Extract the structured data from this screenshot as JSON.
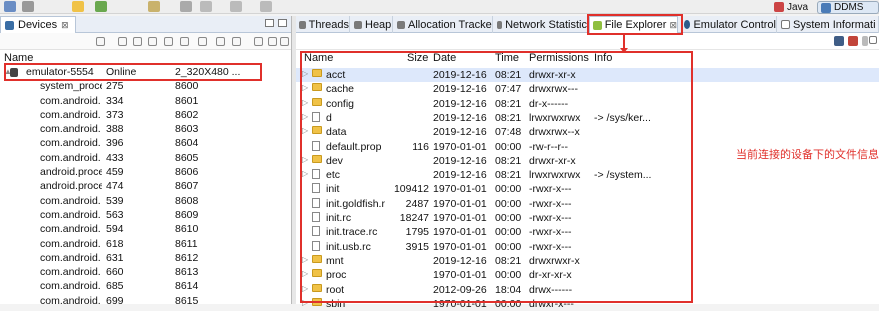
{
  "perspectives": {
    "java": "Java",
    "ddms": "DDMS"
  },
  "devices_panel": {
    "tab_label": "Devices",
    "close_glyph": "⊠",
    "column_name": "Name",
    "emulator": {
      "name": "emulator-5554",
      "status": "Online",
      "avd": "2_320X480 ..."
    },
    "processes": [
      {
        "name": "system_proce",
        "pid": "275",
        "port": "8600"
      },
      {
        "name": "com.android.",
        "pid": "334",
        "port": "8601"
      },
      {
        "name": "com.android.",
        "pid": "373",
        "port": "8602"
      },
      {
        "name": "com.android.",
        "pid": "388",
        "port": "8603"
      },
      {
        "name": "com.android.",
        "pid": "396",
        "port": "8604"
      },
      {
        "name": "com.android.",
        "pid": "433",
        "port": "8605"
      },
      {
        "name": "android.proce",
        "pid": "459",
        "port": "8606"
      },
      {
        "name": "android.proce",
        "pid": "474",
        "port": "8607"
      },
      {
        "name": "com.android.",
        "pid": "539",
        "port": "8608"
      },
      {
        "name": "com.android.",
        "pid": "563",
        "port": "8609"
      },
      {
        "name": "com.android.",
        "pid": "594",
        "port": "8610"
      },
      {
        "name": "com.android.",
        "pid": "618",
        "port": "8611"
      },
      {
        "name": "com.android.",
        "pid": "631",
        "port": "8612"
      },
      {
        "name": "com.android.",
        "pid": "660",
        "port": "8613"
      },
      {
        "name": "com.android.",
        "pid": "685",
        "port": "8614"
      },
      {
        "name": "com.android.",
        "pid": "699",
        "port": "8615"
      }
    ]
  },
  "tabs": [
    {
      "label": "Threads",
      "icon": "threads-icon"
    },
    {
      "label": "Heap",
      "icon": "heap-icon"
    },
    {
      "label": "Allocation Tracke",
      "icon": "allocation-icon"
    },
    {
      "label": "Network Statistic",
      "icon": "network-icon"
    },
    {
      "label": "File Explorer",
      "icon": "android-icon",
      "active": true
    },
    {
      "label": "Emulator Control",
      "icon": "emulator-icon"
    },
    {
      "label": "System Informati",
      "icon": "info-icon"
    }
  ],
  "file_explorer": {
    "columns": {
      "name": "Name",
      "size": "Size",
      "date": "Date",
      "time": "Time",
      "permissions": "Permissions",
      "info": "Info"
    },
    "rows": [
      {
        "name": "acct",
        "size": "",
        "date": "2019-12-16",
        "time": "08:21",
        "perm": "drwxr-xr-x",
        "info": "",
        "type": "folder",
        "expandable": true,
        "selected": true
      },
      {
        "name": "cache",
        "size": "",
        "date": "2019-12-16",
        "time": "07:47",
        "perm": "drwxrwx---",
        "info": "",
        "type": "folder",
        "expandable": true
      },
      {
        "name": "config",
        "size": "",
        "date": "2019-12-16",
        "time": "08:21",
        "perm": "dr-x------",
        "info": "",
        "type": "folder",
        "expandable": true
      },
      {
        "name": "d",
        "size": "",
        "date": "2019-12-16",
        "time": "08:21",
        "perm": "lrwxrwxrwx",
        "info": "-> /sys/ker...",
        "type": "file",
        "expandable": true
      },
      {
        "name": "data",
        "size": "",
        "date": "2019-12-16",
        "time": "07:48",
        "perm": "drwxrwx--x",
        "info": "",
        "type": "folder",
        "expandable": true
      },
      {
        "name": "default.prop",
        "size": "116",
        "date": "1970-01-01",
        "time": "00:00",
        "perm": "-rw-r--r--",
        "info": "",
        "type": "file",
        "expandable": false
      },
      {
        "name": "dev",
        "size": "",
        "date": "2019-12-16",
        "time": "08:21",
        "perm": "drwxr-xr-x",
        "info": "",
        "type": "folder",
        "expandable": true
      },
      {
        "name": "etc",
        "size": "",
        "date": "2019-12-16",
        "time": "08:21",
        "perm": "lrwxrwxrwx",
        "info": "-> /system...",
        "type": "file",
        "expandable": true
      },
      {
        "name": "init",
        "size": "109412",
        "date": "1970-01-01",
        "time": "00:00",
        "perm": "-rwxr-x---",
        "info": "",
        "type": "file",
        "expandable": false
      },
      {
        "name": "init.goldfish.r",
        "size": "2487",
        "date": "1970-01-01",
        "time": "00:00",
        "perm": "-rwxr-x---",
        "info": "",
        "type": "file",
        "expandable": false
      },
      {
        "name": "init.rc",
        "size": "18247",
        "date": "1970-01-01",
        "time": "00:00",
        "perm": "-rwxr-x---",
        "info": "",
        "type": "file",
        "expandable": false
      },
      {
        "name": "init.trace.rc",
        "size": "1795",
        "date": "1970-01-01",
        "time": "00:00",
        "perm": "-rwxr-x---",
        "info": "",
        "type": "file",
        "expandable": false
      },
      {
        "name": "init.usb.rc",
        "size": "3915",
        "date": "1970-01-01",
        "time": "00:00",
        "perm": "-rwxr-x---",
        "info": "",
        "type": "file",
        "expandable": false
      },
      {
        "name": "mnt",
        "size": "",
        "date": "2019-12-16",
        "time": "08:21",
        "perm": "drwxrwxr-x",
        "info": "",
        "type": "folder",
        "expandable": true
      },
      {
        "name": "proc",
        "size": "",
        "date": "1970-01-01",
        "time": "00:00",
        "perm": "dr-xr-xr-x",
        "info": "",
        "type": "folder",
        "expandable": true
      },
      {
        "name": "root",
        "size": "",
        "date": "2012-09-26",
        "time": "18:04",
        "perm": "drwx------",
        "info": "",
        "type": "folder",
        "expandable": true
      },
      {
        "name": "sbin",
        "size": "",
        "date": "1970-01-01",
        "time": "00:00",
        "perm": "drwxr-x---",
        "info": "",
        "type": "folder",
        "expandable": true
      }
    ]
  },
  "annotation": "当前连接的设备下的文件信息",
  "colors": {
    "highlight": "#e0302b",
    "selection": "#dde8fb"
  }
}
